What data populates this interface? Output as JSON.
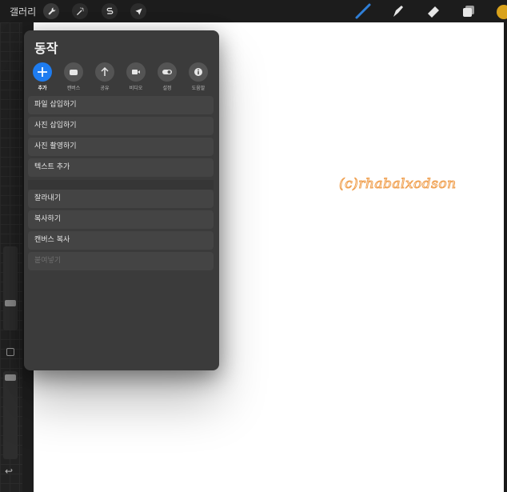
{
  "toolbar": {
    "gallery_label": "갤러리",
    "left_tools": [
      "wrench-icon",
      "magic-wand-icon",
      "selection-s-icon",
      "arrow-cursor-icon"
    ],
    "right_tools": [
      "brush-icon",
      "smudge-icon",
      "eraser-icon",
      "layers-icon"
    ],
    "brush_color": "#2f7fd8",
    "current_color": "#d9a21b"
  },
  "canvas": {
    "watermark": "(c)rhabalxodson",
    "watermark_color": "#f0a050"
  },
  "sidebar": {
    "undo_symbol": "↩"
  },
  "panel": {
    "title": "동작",
    "tabs": [
      {
        "label": "추가",
        "icon": "plus-icon",
        "active": true
      },
      {
        "label": "캔버스",
        "icon": "canvas-icon"
      },
      {
        "label": "공유",
        "icon": "share-icon"
      },
      {
        "label": "비디오",
        "icon": "video-icon"
      },
      {
        "label": "설정",
        "icon": "toggle-icon"
      },
      {
        "label": "도움말",
        "icon": "info-icon"
      }
    ],
    "items": [
      {
        "label": "파일 삽입하기"
      },
      {
        "label": "사진 삽입하기"
      },
      {
        "label": "사진 촬영하기"
      },
      {
        "label": "텍스트 추가"
      },
      {
        "label": "잘라내기"
      },
      {
        "label": "복사하기"
      },
      {
        "label": "캔버스 복사"
      },
      {
        "label": "붙여넣기",
        "disabled": true
      }
    ],
    "accent_color": "#1e7cf0"
  }
}
